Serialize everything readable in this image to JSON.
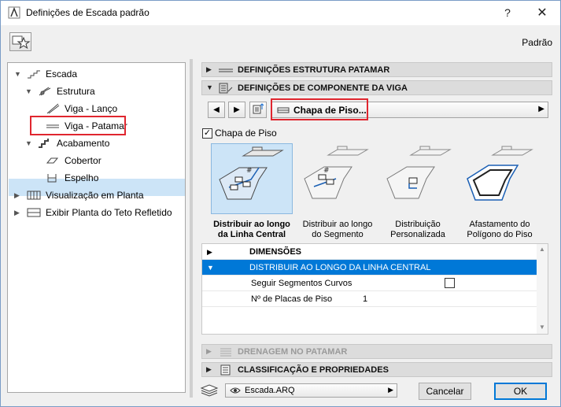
{
  "window": {
    "title": "Definições de Escada padrão",
    "help_label": "?",
    "close_label": "✕"
  },
  "header": {
    "favorite_label": "Padrão"
  },
  "tree": {
    "items": [
      {
        "label": "Escada"
      },
      {
        "label": "Estrutura"
      },
      {
        "label": "Viga - Lanço"
      },
      {
        "label": "Viga - Patamar"
      },
      {
        "label": "Acabamento"
      },
      {
        "label": "Cobertor"
      },
      {
        "label": "Espelho"
      },
      {
        "label": "Visualização em Planta"
      },
      {
        "label": "Exibir Planta do Teto Refletido"
      }
    ],
    "selected": "Viga - Patamar"
  },
  "sections": {
    "estrutura_patamar": "DEFINIÇÕES ESTRUTURA PATAMAR",
    "componente_viga": "DEFINIÇÕES DE COMPONENTE DA VIGA",
    "drenagem": "DRENAGEM NO PATAMAR",
    "classificacao": "CLASSIFICAÇÃO E PROPRIEDADES"
  },
  "component": {
    "selected": "Chapa de Piso...",
    "checkbox_label": "Chapa de Piso",
    "checkbox_checked": true,
    "options": [
      {
        "line1": "Distribuir ao longo",
        "line2": "da Linha Central",
        "selected": true
      },
      {
        "line1": "Distribuir ao longo",
        "line2": "do Segmento",
        "selected": false
      },
      {
        "line1": "Distribuição",
        "line2": "Personalizada",
        "selected": false
      },
      {
        "line1": "Afastamento do",
        "line2": "Polígono do Piso",
        "selected": false
      }
    ]
  },
  "grid": {
    "rows": [
      {
        "label": "DIMENSÕES",
        "value": ""
      },
      {
        "label": "DISTRIBUIR AO LONGO DA LINHA CENTRAL",
        "value": ""
      },
      {
        "label": "Seguir Segmentos Curvos",
        "value": ""
      },
      {
        "label": "Nº de Placas de Piso",
        "value": "1"
      }
    ]
  },
  "footer": {
    "favorite_file": "Escada.ARQ",
    "cancel_label": "Cancelar",
    "ok_label": "OK"
  },
  "colors": {
    "selection": "#cce4f7",
    "highlight": "#0078d7",
    "annotation": "#e0262f"
  }
}
